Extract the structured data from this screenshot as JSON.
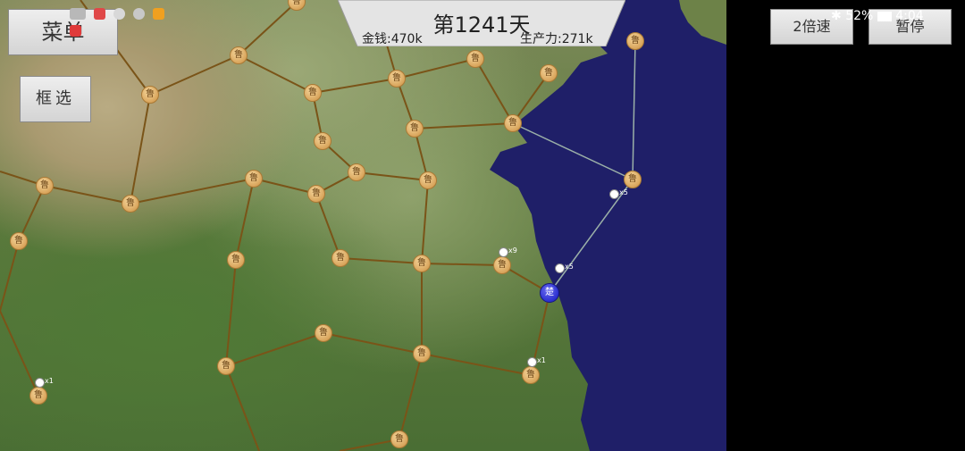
{
  "status_bar": {
    "battery": "52%",
    "time": "4:04"
  },
  "top_panel": {
    "day": "第1241天",
    "money": "金钱:470k",
    "production": "生产力:271k"
  },
  "buttons": {
    "menu": "菜单",
    "box_select": "框选",
    "speed": "2倍速",
    "pause": "暂停"
  },
  "map": {
    "city_glyph_lu": "鲁",
    "city_glyph_chu": "楚",
    "armies": [
      {
        "count": "x5"
      },
      {
        "count": "x9"
      },
      {
        "count": "x5"
      },
      {
        "count": "x1"
      },
      {
        "count": "x1"
      }
    ]
  },
  "colors": {
    "sea": "#1f1f68",
    "road": "#7a5418",
    "sea_route": "#9bb0a8",
    "city": "#d9a55c",
    "player_city": "#2b2fcf"
  }
}
